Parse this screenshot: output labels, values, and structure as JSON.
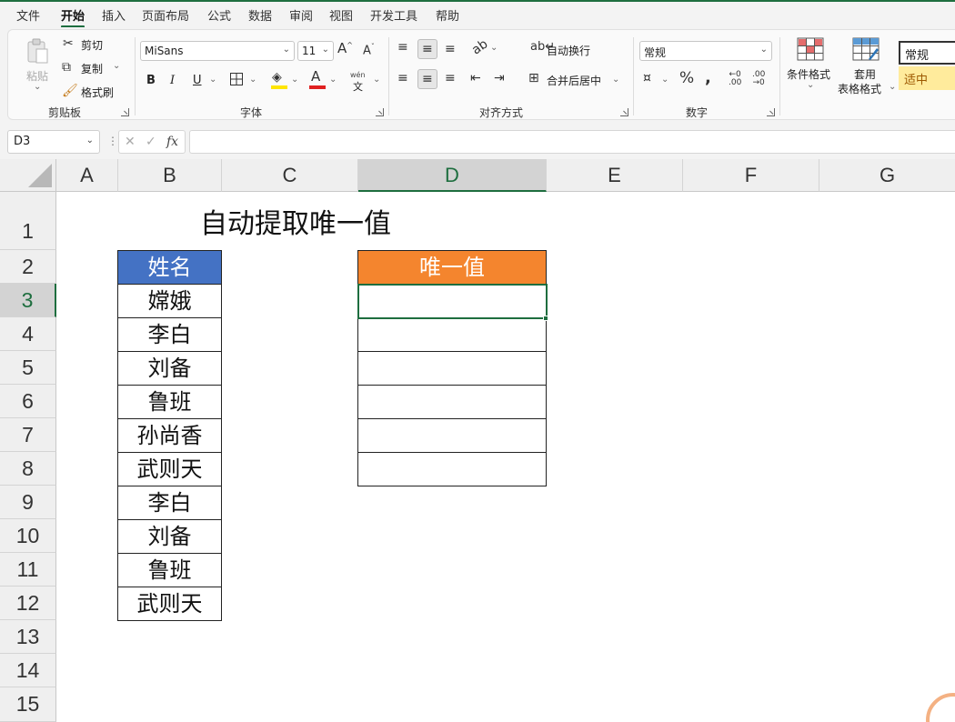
{
  "menu": {
    "items": [
      {
        "label": "文件",
        "active": false
      },
      {
        "label": "开始",
        "active": true
      },
      {
        "label": "插入",
        "active": false
      },
      {
        "label": "页面布局",
        "active": false
      },
      {
        "label": "公式",
        "active": false
      },
      {
        "label": "数据",
        "active": false
      },
      {
        "label": "审阅",
        "active": false
      },
      {
        "label": "视图",
        "active": false
      },
      {
        "label": "开发工具",
        "active": false
      },
      {
        "label": "帮助",
        "active": false
      }
    ]
  },
  "ribbon": {
    "clipboard": {
      "paste": "粘贴",
      "cut": "剪切",
      "copy": "复制",
      "format_painter": "格式刷",
      "group_label": "剪贴板"
    },
    "font": {
      "font_name": "MiSans",
      "font_size": "11",
      "bold": "B",
      "italic": "I",
      "underline": "U",
      "phonetic": "wén",
      "group_label": "字体"
    },
    "alignment": {
      "wrap_text": "自动换行",
      "merge_center": "合并后居中",
      "group_label": "对齐方式"
    },
    "number": {
      "format": "常规",
      "group_label": "数字"
    },
    "styles": {
      "conditional_format": "条件格式",
      "table_format_line1": "套用",
      "table_format_line2": "表格格式",
      "style_normal": "常规",
      "style_neutral": "适中"
    }
  },
  "formula_bar": {
    "name_box": "D3",
    "formula": ""
  },
  "grid": {
    "columns": [
      "A",
      "B",
      "C",
      "D",
      "E",
      "F",
      "G"
    ],
    "selected_column": "D",
    "rows": [
      "1",
      "2",
      "3",
      "4",
      "5",
      "6",
      "7",
      "8",
      "9",
      "10",
      "11",
      "12",
      "13",
      "14",
      "15"
    ],
    "selected_row": "3",
    "title": "自动提取唯一值",
    "name_header": "姓名",
    "names": [
      "嫦娥",
      "李白",
      "刘备",
      "鲁班",
      "孙尚香",
      "武则天",
      "李白",
      "刘备",
      "鲁班",
      "武则天"
    ],
    "unique_header": "唯一值",
    "unique_values": [
      "",
      "",
      "",
      "",
      "",
      ""
    ]
  },
  "colors": {
    "accent": "#1e6e3f",
    "name_header_bg": "#4472c4",
    "unique_header_bg": "#f4852e"
  }
}
